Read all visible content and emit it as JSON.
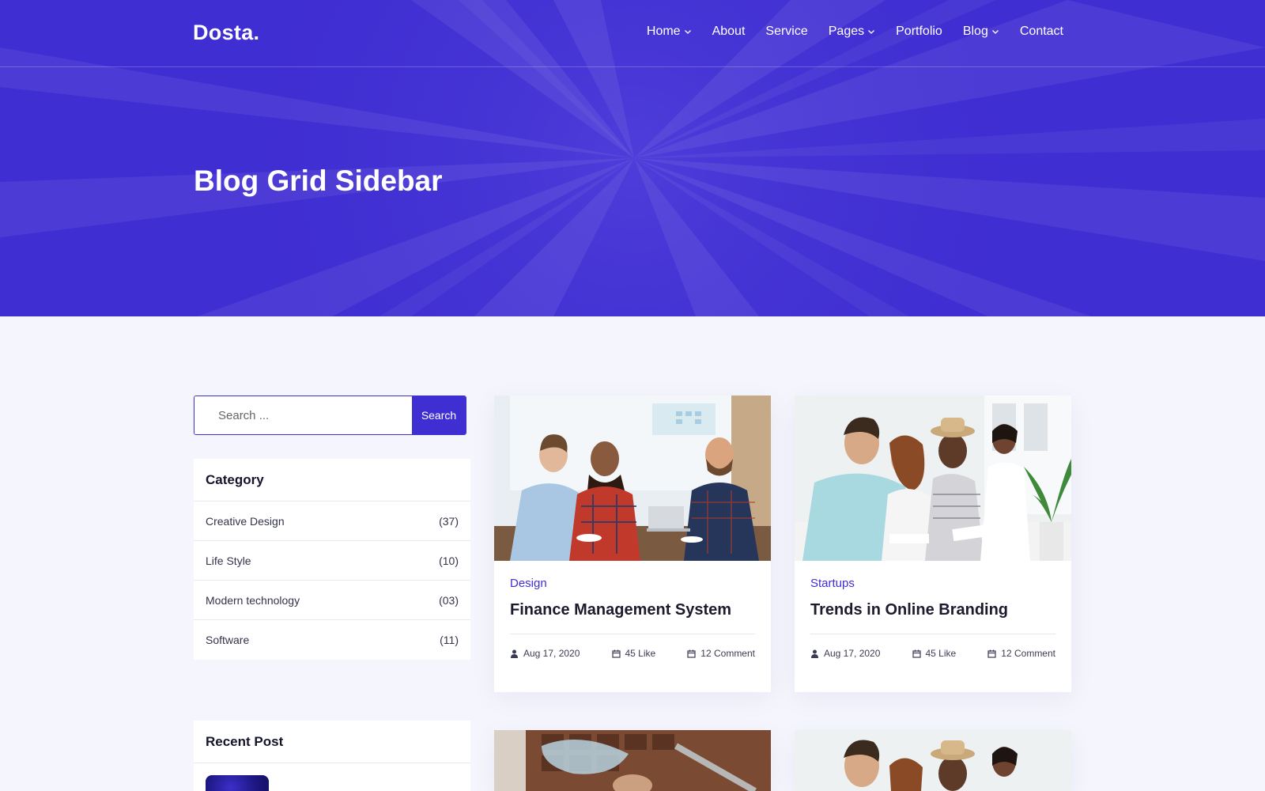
{
  "header": {
    "logo": "Dosta.",
    "nav": [
      {
        "label": "Home",
        "dropdown": true
      },
      {
        "label": "About",
        "dropdown": false
      },
      {
        "label": "Service",
        "dropdown": false
      },
      {
        "label": "Pages",
        "dropdown": true
      },
      {
        "label": "Portfolio",
        "dropdown": false
      },
      {
        "label": "Blog",
        "dropdown": true
      },
      {
        "label": "Contact",
        "dropdown": false
      }
    ]
  },
  "hero": {
    "title": "Blog Grid Sidebar"
  },
  "search": {
    "placeholder": "Search ...",
    "button_label": "Search"
  },
  "sidebar": {
    "category_title": "Category",
    "categories": [
      {
        "name": "Creative Design",
        "count": "(37)"
      },
      {
        "name": "Life Style",
        "count": "(10)"
      },
      {
        "name": "Modern technology",
        "count": "(03)"
      },
      {
        "name": "Software",
        "count": "(11)"
      }
    ],
    "recent_title": "Recent Post"
  },
  "posts": [
    {
      "category": "Design",
      "title": "Finance Management System",
      "date": "Aug 17, 2020",
      "likes": "45 Like",
      "comments": "12 Comment"
    },
    {
      "category": "Startups",
      "title": "Trends in Online Branding",
      "date": "Aug 17, 2020",
      "likes": "45 Like",
      "comments": "12 Comment"
    }
  ],
  "colors": {
    "primary": "#3f2ed2",
    "page_bg": "#f5f5fd",
    "text_dark": "#1c1b2e"
  }
}
